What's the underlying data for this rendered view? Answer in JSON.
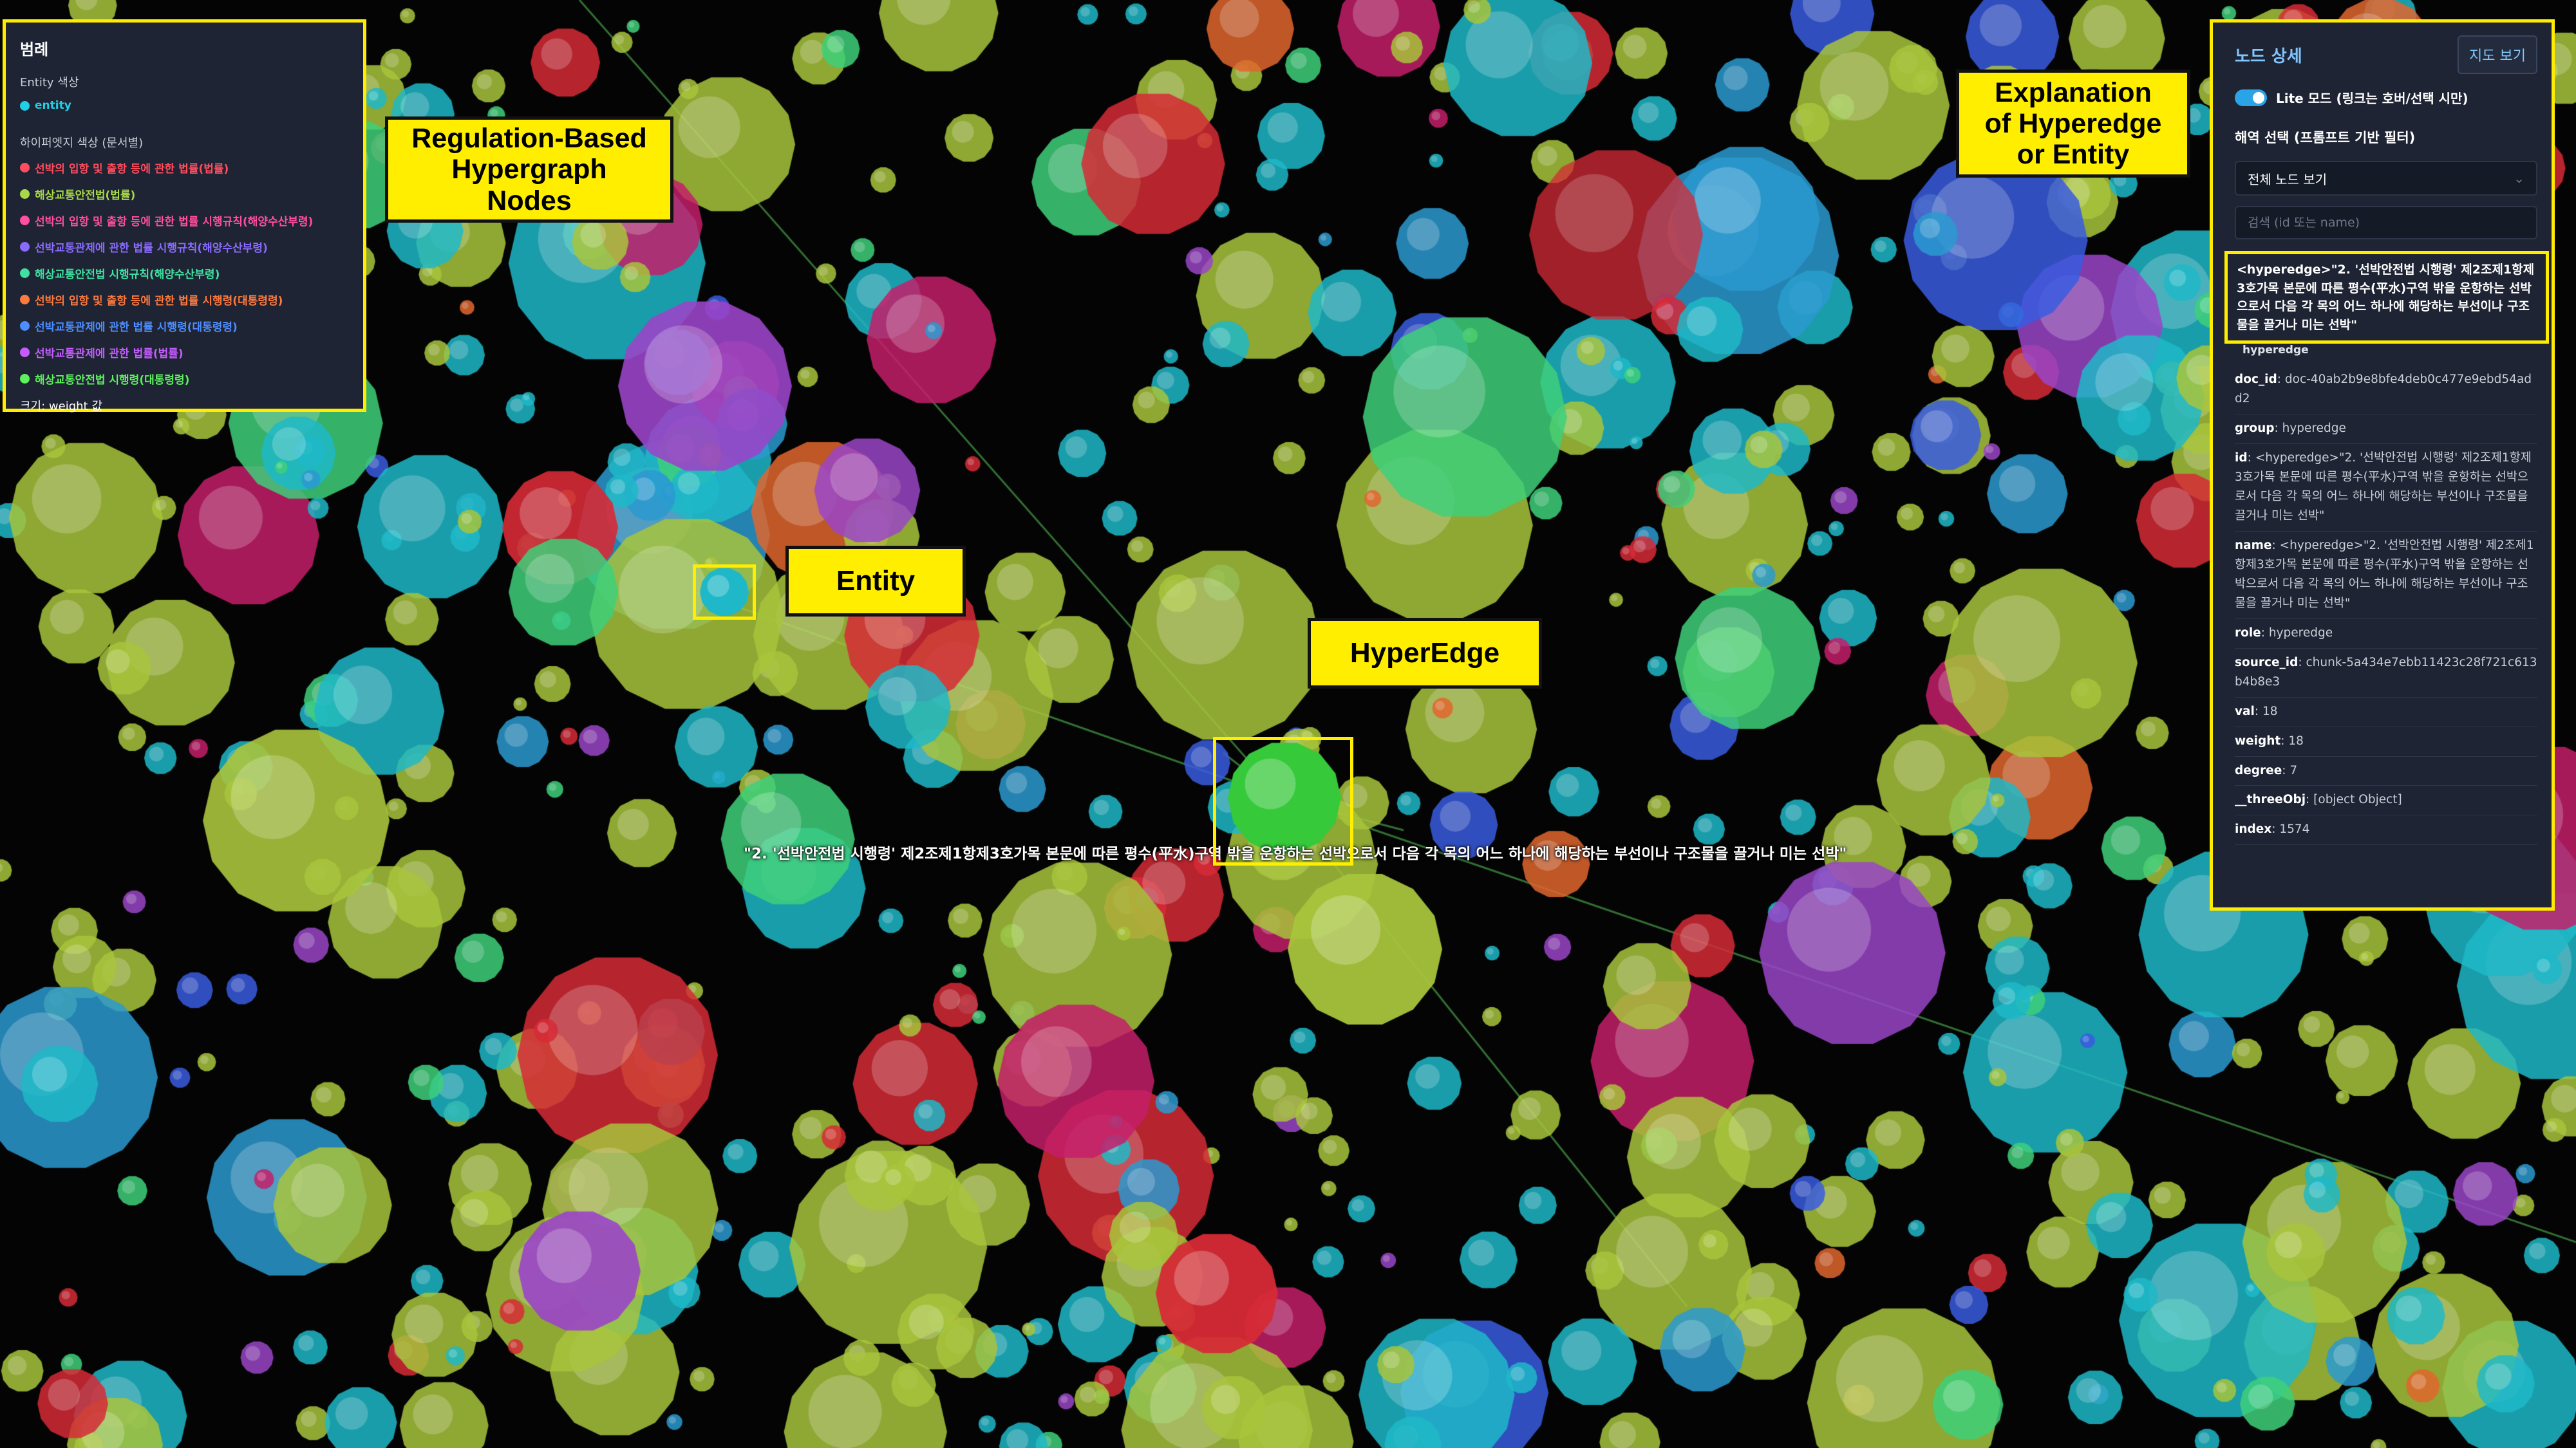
{
  "legend": {
    "title": "범례",
    "entity_section": "Entity 색상",
    "entity_label": "entity",
    "hyperedge_section": "하이퍼엣지 색상 (문서별)",
    "items": [
      {
        "label": "선박의 입항 및 출항 등에 관한 법률(법률)",
        "color": "#ff4d5e"
      },
      {
        "label": "해상교통안전법(법률)",
        "color": "#a8d84a"
      },
      {
        "label": "선박의 입항 및 출항 등에 관한 법률 시행규칙(해양수산부령)",
        "color": "#ff4fa0"
      },
      {
        "label": "선박교통관제에 관한 법률 시행규칙(해양수산부령)",
        "color": "#8a6bff"
      },
      {
        "label": "해상교통안전법 시행규칙(해양수산부령)",
        "color": "#3fe0a0"
      },
      {
        "label": "선박의 입항 및 출항 등에 관한 법률 시행령(대통령령)",
        "color": "#ff7a3d"
      },
      {
        "label": "선박교통관제에 관한 법률 시행령(대통령령)",
        "color": "#4c8dff"
      },
      {
        "label": "선박교통관제에 관한 법률(법률)",
        "color": "#c55cff"
      },
      {
        "label": "해상교통안전법 시행령(대통령령)",
        "color": "#5ef05e"
      }
    ],
    "entity_color": "#20d0e8",
    "size_note": "크기: weight 값"
  },
  "annotations": {
    "nodes": "Regulation-Based\nHypergraph\nNodes",
    "entity": "Entity",
    "hyperedge": "HyperEdge",
    "explanation": "Explanation\nof Hyperedge\nor Entity"
  },
  "hover_label": "\"2. '선박안전법 시행령' 제2조제1항제3호가목 본문에 따른 평수(平水)구역 밖을 운항하는 선박으로서 다음 각 목의 어느 하나에 해당하는 부선이나 구조물을 끌거나 미는 선박\"",
  "panel": {
    "title": "노드 상세",
    "map_button": "지도 보기",
    "lite_mode": "Lite 모드 (링크는 호버/선택 시만)",
    "region_label": "해역 선택 (프롬프트 기반 필터)",
    "region_select": "전체 노드 보기",
    "search_placeholder": "검색 (id 또는 name)",
    "node_name": "<hyperedge>\"2. '선박안전법 시행령' 제2조제1항제3호가목 본문에 따른 평수(平水)구역 밖을 운항하는 선박으로서 다음 각 목의 어느 하나에 해당하는 부선이나 구조물을 끌거나 미는 선박\"",
    "node_group": "hyperedge",
    "props": [
      {
        "key": "doc_id",
        "value": "doc-40ab2b9e8bfe4deb0c477e9ebd54add2"
      },
      {
        "key": "group",
        "value": "hyperedge"
      },
      {
        "key": "id",
        "value": "<hyperedge>\"2. '선박안전법 시행령' 제2조제1항제3호가목 본문에 따른 평수(平水)구역 밖을 운항하는 선박으로서 다음 각 목의 어느 하나에 해당하는 부선이나 구조물을 끌거나 미는 선박\""
      },
      {
        "key": "name",
        "value": "<hyperedge>\"2. '선박안전법 시행령' 제2조제1항제3호가목 본문에 따른 평수(平水)구역 밖을 운항하는 선박으로서 다음 각 목의 어느 하나에 해당하는 부선이나 구조물을 끌거나 미는 선박\""
      },
      {
        "key": "role",
        "value": "hyperedge"
      },
      {
        "key": "source_id",
        "value": "chunk-5a434e7ebb11423c28f721c613b4b8e3"
      },
      {
        "key": "val",
        "value": "18"
      },
      {
        "key": "weight",
        "value": "18"
      },
      {
        "key": "degree",
        "value": "7"
      },
      {
        "key": "__threeObj",
        "value": "[object Object]"
      },
      {
        "key": "index",
        "value": "1574"
      }
    ]
  }
}
